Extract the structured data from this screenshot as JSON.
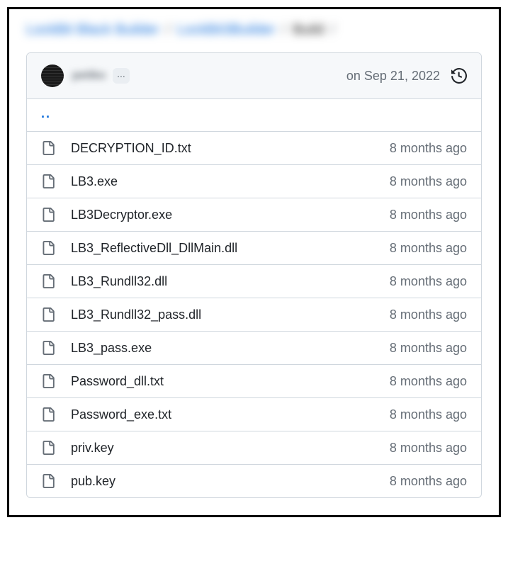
{
  "breadcrumb": {
    "part1": "LockBit Black Builder",
    "part2": "LockBit3Builder",
    "part3": "Build",
    "sep": "/"
  },
  "commit": {
    "username": "petiko",
    "more": "...",
    "date": "on Sep 21, 2022"
  },
  "parent_link": "..",
  "files": [
    {
      "name": "DECRYPTION_ID.txt",
      "time": "8 months ago"
    },
    {
      "name": "LB3.exe",
      "time": "8 months ago"
    },
    {
      "name": "LB3Decryptor.exe",
      "time": "8 months ago"
    },
    {
      "name": "LB3_ReflectiveDll_DllMain.dll",
      "time": "8 months ago"
    },
    {
      "name": "LB3_Rundll32.dll",
      "time": "8 months ago"
    },
    {
      "name": "LB3_Rundll32_pass.dll",
      "time": "8 months ago"
    },
    {
      "name": "LB3_pass.exe",
      "time": "8 months ago"
    },
    {
      "name": "Password_dll.txt",
      "time": "8 months ago"
    },
    {
      "name": "Password_exe.txt",
      "time": "8 months ago"
    },
    {
      "name": "priv.key",
      "time": "8 months ago"
    },
    {
      "name": "pub.key",
      "time": "8 months ago"
    }
  ]
}
